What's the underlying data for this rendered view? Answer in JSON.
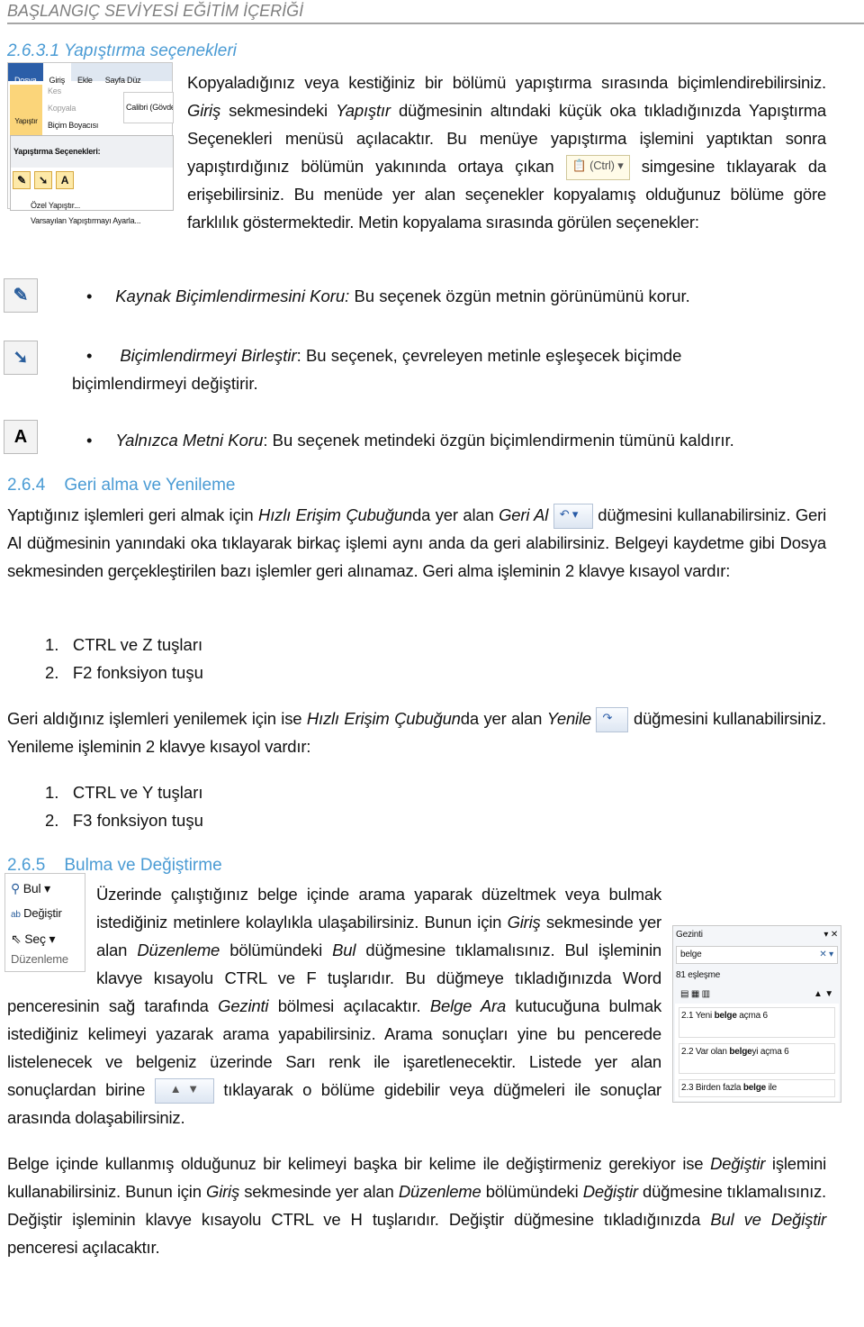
{
  "header": "BAŞLANGIÇ SEVİYESİ EĞİTİM İÇERİĞİ",
  "s1": {
    "title": "2.6.3.1 Yapıştırma seçenekleri",
    "ribbon": {
      "tabs": [
        "Dosya",
        "Giriş",
        "Ekle",
        "Sayfa Düz"
      ],
      "paste": "Yapıştır",
      "cut": "Kes",
      "copy": "Kopyala",
      "painter": "Biçim Boyacısı",
      "font": "Calibri (Gövde",
      "menu_title": "Yapıştırma Seçenekleri:",
      "special": "Özel Yapıştır...",
      "default": "Varsayılan Yapıştırmayı Ayarla..."
    },
    "p1a": "Kopyaladığınız veya kestiğiniz bir bölümü yapıştırma sırasında biçimlendirebilirsiniz. ",
    "p1b": "Giriş",
    "p1c": " sekmesindeki ",
    "p1d": "Yapıştır",
    "p1e": " düğmesinin altındaki küçük oka tıkladığınızda Yapıştırma Seçenekleri menüsü açılacaktır. Bu menüye yapıştırma işlemini yaptıktan sonra yapıştırdığınız bölümün yakınında ortaya çıkan ",
    "ctrl": "(Ctrl)",
    "p1f": " simgesine tıklayarak da erişebilirsiniz. Bu menüde yer alan seçenekler kopyalamış olduğunuz bölüme göre farklılık göstermektedir. Metin kopyalama sırasında görülen seçenekler:",
    "opts": [
      {
        "name": "Kaynak Biçimlendirmesini Koru:",
        "desc": " Bu seçenek özgün metnin görünümünü korur."
      },
      {
        "name": "Biçimlendirmeyi Birleştir",
        "desc": ": Bu seçenek, çevreleyen metinle eşleşecek biçimde",
        "desc2": "biçimlendirmeyi değiştirir."
      },
      {
        "name": "Yalnızca Metni Koru",
        "desc": ": Bu seçenek metindeki özgün biçimlendirmenin tümünü kaldırır."
      }
    ]
  },
  "s2": {
    "title": "2.6.4    Geri alma ve Yenileme",
    "p1a": "Yaptığınız işlemleri geri almak için ",
    "p1b": "Hızlı Erişim Çubuğun",
    "p1c": "da yer alan ",
    "p1d": "Geri Al",
    "p1e": " düğmesini kullanabilirsiniz. Geri Al düğmesinin yanındaki oka tıklayarak birkaç işlemi aynı anda da geri alabilirsiniz. Belgeyi kaydetme gibi Dosya sekmesinden gerçekleştirilen bazı işlemler geri alınamaz. Geri alma işleminin 2 klavye kısayol vardır:",
    "list1": [
      {
        "n": "1.",
        "t": "CTRL ve Z tuşları"
      },
      {
        "n": "2.",
        "t": "F2 fonksiyon tuşu"
      }
    ],
    "p2a": "Geri aldığınız işlemleri yenilemek için ise ",
    "p2b": "Hızlı Erişim Çubuğun",
    "p2c": "da yer alan ",
    "p2d": "Yenile",
    "p2e": " düğmesini kullanabilirsiniz. Yenileme işleminin 2 klavye kısayol vardır:",
    "list2": [
      {
        "n": "1.",
        "t": "CTRL ve Y tuşları"
      },
      {
        "n": "2.",
        "t": "F3 fonksiyon tuşu"
      }
    ]
  },
  "s3": {
    "title": "2.6.5    Bulma ve Değiştirme",
    "dz": {
      "find": "Bul",
      "replace": "Değiştir",
      "select": "Seç",
      "group": "Düzenleme"
    },
    "gz": {
      "title": "Gezinti",
      "query": "belge",
      "count": "81 eşleşme",
      "results": [
        [
          "2.1 Yeni ",
          "belge",
          " açma 6"
        ],
        [
          "2.2 Var olan ",
          "belge",
          "yi açma 6"
        ],
        [
          "2.3 Birden fazla ",
          "belge",
          " ile"
        ]
      ]
    },
    "p1a": "Üzerinde çalıştığınız belge içinde arama yaparak düzeltmek veya bulmak istediğiniz metinlere kolaylıkla ulaşabilirsiniz. Bunun için ",
    "p1b": "Giriş",
    "p1c": " sekmesinde yer alan ",
    "p1d": "Düzenleme",
    "p1e": " bölümündeki ",
    "p1f": "Bul",
    "p1g": " düğmesine tıklamalısınız. Bul işleminin klavye kısayolu CTRL ve F tuşlarıdır. Bu düğmeye tıkladığınızda Word penceresinin sağ tarafında ",
    "p1h": "Gezinti",
    "p1i": " bölmesi açılacaktır. ",
    "p1j": "Belge Ara",
    "p1k": " kutucuğuna bulmak istediğiniz kelimeyi yazarak arama yapabilirsiniz. Arama sonuçları yine bu pencerede listelenecek ve belgeniz üzerinde Sarı renk ile işaretlenecektir. Listede yer alan sonuçlardan birine ",
    "p1l": " tıklayarak o bölüme gidebilir veya düğmeleri ile sonuçlar arasında dolaşabilirsiniz.",
    "p2a": "Belge içinde kullanmış olduğunuz bir kelimeyi başka bir kelime ile değiştirmeniz gerekiyor ise ",
    "p2b": "Değiştir",
    "p2c": " işlemini kullanabilirsiniz. Bunun için ",
    "p2d": "Giriş",
    "p2e": " sekmesinde yer alan ",
    "p2f": "Düzenleme",
    "p2g": " bölümündeki ",
    "p2h": "Değiştir",
    "p2i": " düğmesine tıklamalısınız.  Değiştir işleminin klavye kısayolu CTRL ve H tuşlarıdır. Değiştir düğmesine tıkladığınızda ",
    "p2j": "Bul ve Değiştir",
    "p2k": " penceresi açılacaktır."
  },
  "colors": {
    "heading": "#4a9bd4",
    "header": "#7f7f7f"
  }
}
